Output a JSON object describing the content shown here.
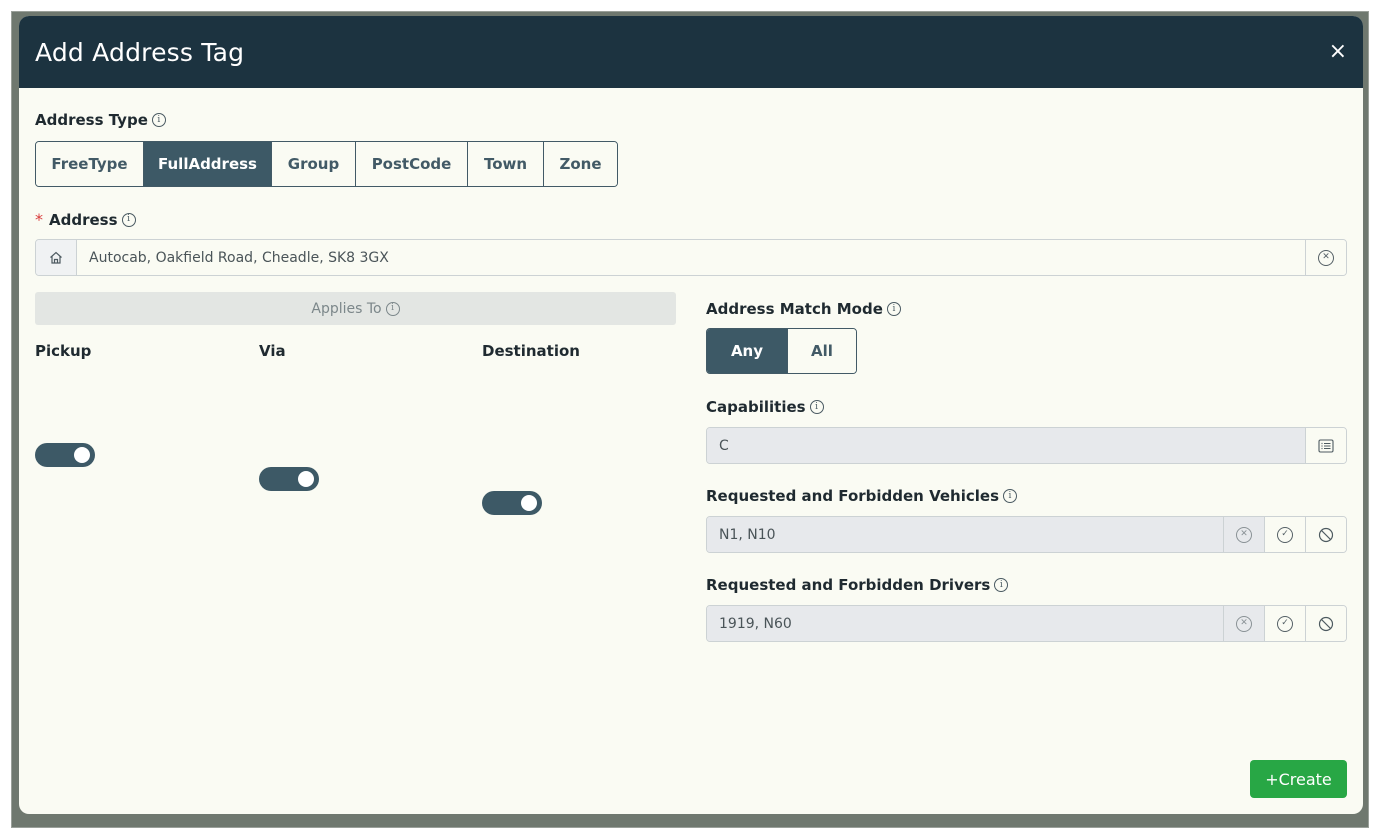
{
  "dialog": {
    "title": "Add Address Tag",
    "close_glyph": "×"
  },
  "address_type": {
    "label": "Address Type",
    "options": [
      "FreeType",
      "FullAddress",
      "Group",
      "PostCode",
      "Town",
      "Zone"
    ],
    "selected": "FullAddress"
  },
  "address": {
    "required_marker": "*",
    "label": "Address",
    "value": "Autocab, Oakfield Road, Cheadle, SK8 3GX",
    "left_icon": "home-icon",
    "right_icon": "clear-circle-icon"
  },
  "applies_to": {
    "label": "Applies To",
    "toggles": [
      {
        "label": "Pickup",
        "on": true
      },
      {
        "label": "Via",
        "on": true
      },
      {
        "label": "Destination",
        "on": true
      }
    ]
  },
  "match_mode": {
    "label": "Address Match Mode",
    "options": [
      "Any",
      "All"
    ],
    "selected": "Any"
  },
  "capabilities": {
    "label": "Capabilities",
    "value": "C",
    "icon": "list-icon"
  },
  "vehicles": {
    "label": "Requested and Forbidden Vehicles",
    "value": "N1, N10"
  },
  "drivers": {
    "label": "Requested and Forbidden Drivers",
    "value": "1919, N60"
  },
  "info_glyph": "i",
  "create_button": {
    "plus": "+",
    "label": "Create",
    "color": "#28a745"
  },
  "colors": {
    "header": "#1c3340",
    "accent": "#3d5966",
    "body": "#fafbf3"
  }
}
